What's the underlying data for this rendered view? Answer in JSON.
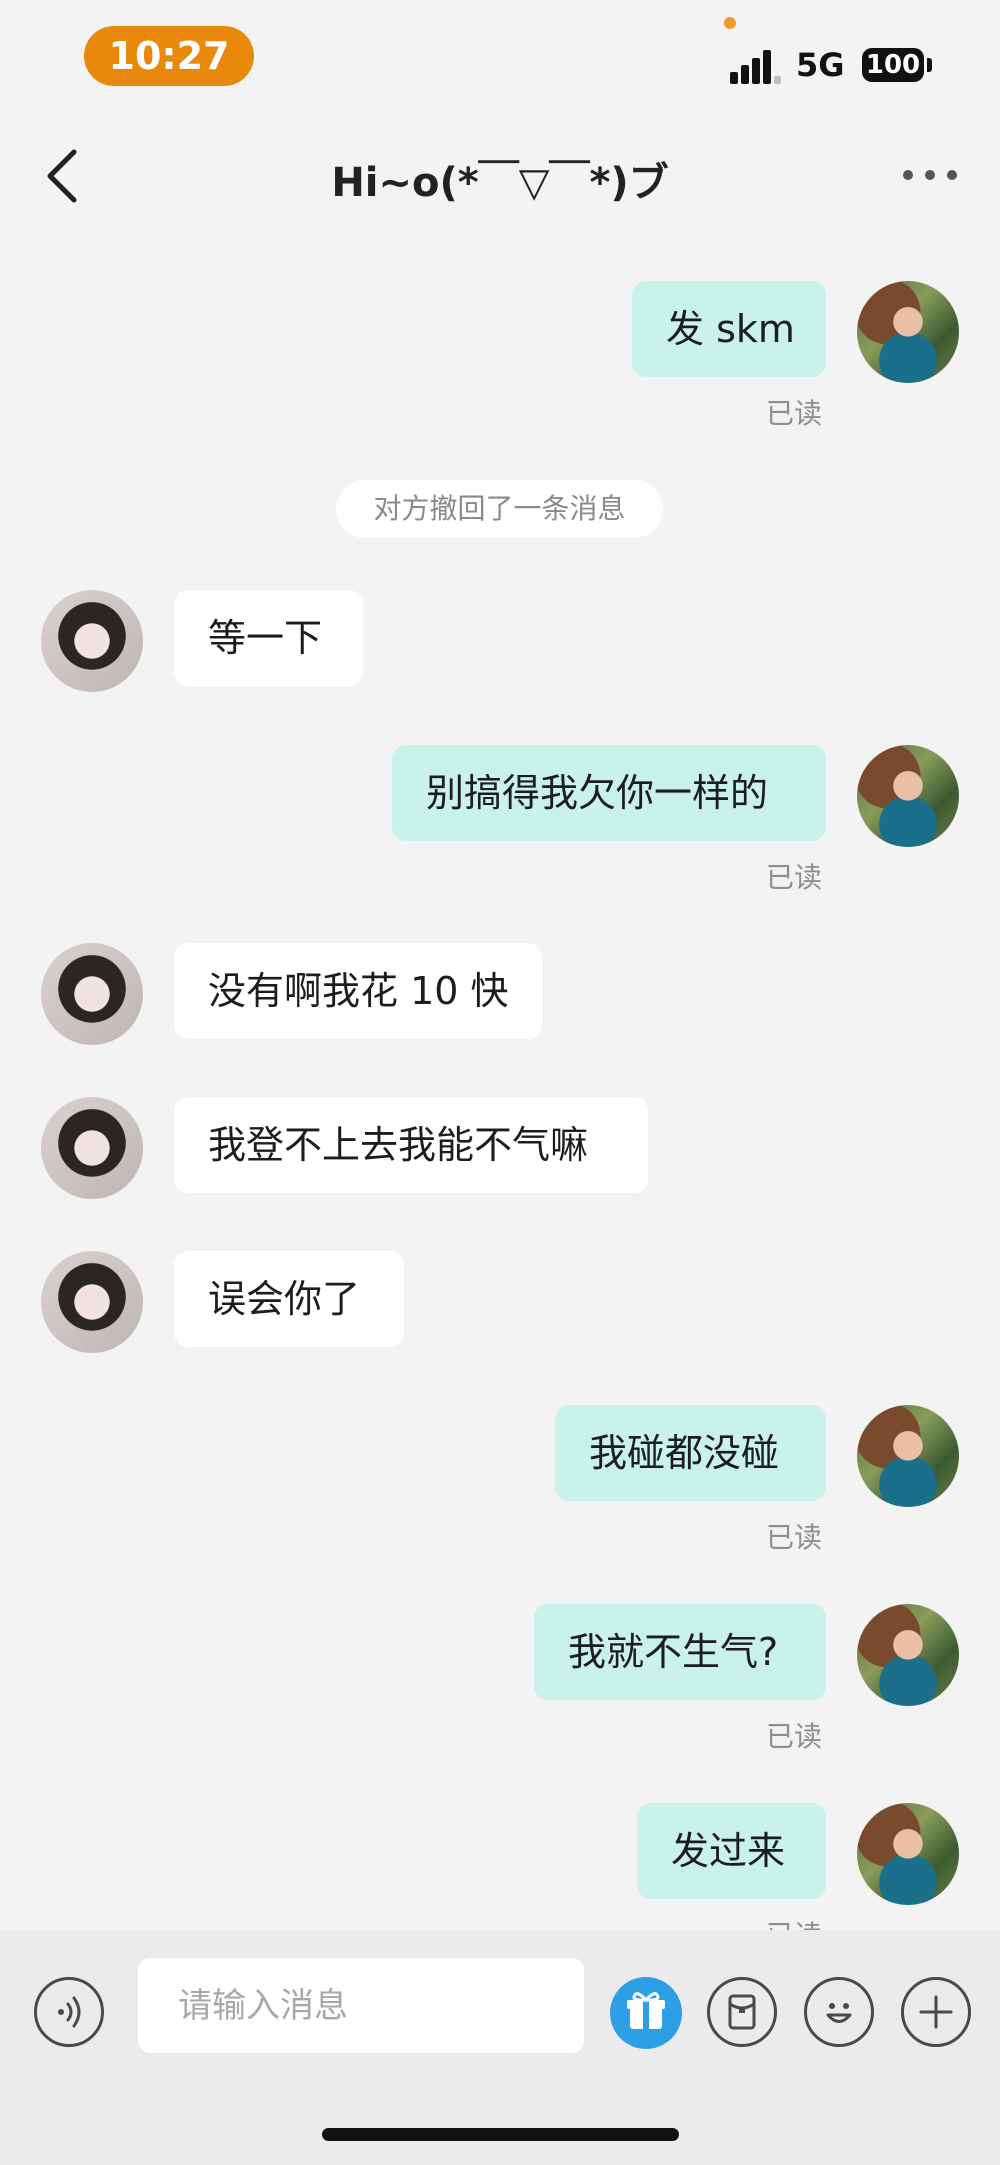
{
  "status_bar": {
    "time": "10:27",
    "network": "5G",
    "battery": "100"
  },
  "header": {
    "title": "Hi~o(*￣▽￣*)ブ"
  },
  "messages": [
    {
      "text": "发 skm",
      "read": "已读"
    },
    {
      "notice": "对方撤回了一条消息"
    },
    {
      "text": "等一下"
    },
    {
      "text": "别搞得我欠你一样的",
      "read": "已读"
    },
    {
      "text": "没有啊我花 10 快"
    },
    {
      "text": "我登不上去我能不气嘛"
    },
    {
      "text": "误会你了"
    },
    {
      "text": "我碰都没碰",
      "read": "已读"
    },
    {
      "text": "我就不生气?",
      "read": "已读"
    },
    {
      "text": "发过来",
      "read": "已读"
    }
  ],
  "input_bar": {
    "placeholder": "请输入消息"
  }
}
